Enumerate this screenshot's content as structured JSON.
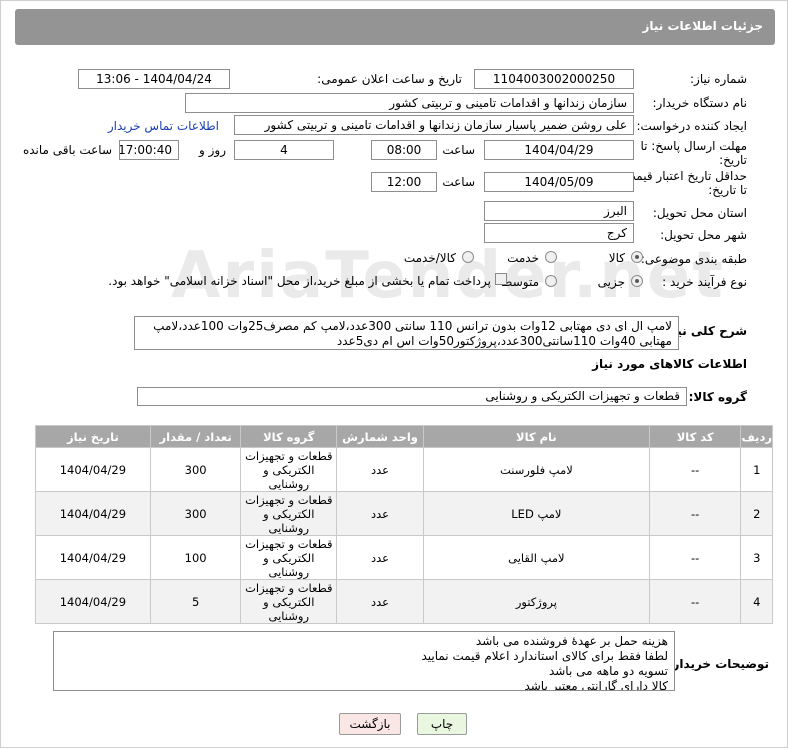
{
  "header": {
    "title": "جزئیات اطلاعات نیاز"
  },
  "watermark": "AriaTender.net",
  "form": {
    "need_number_label": "شماره نیاز:",
    "need_number": "1104003002000250",
    "announce_label": "تاریخ و ساعت اعلان عمومی:",
    "announce_value": "1404/04/24 - 13:06",
    "buyer_label": "نام دستگاه خریدار:",
    "buyer_value": "سازمان زندانها و اقدامات تامینی و تربیتی کشور",
    "creator_label": "ایجاد کننده درخواست:",
    "creator_value": "علی روشن ضمیر پاسیار سازمان زندانها و اقدامات تامینی و تربیتی کشور",
    "contact_link": "اطلاعات تماس خریدار",
    "deadline_label_1": "مهلت ارسال پاسخ: تا",
    "deadline_label_2": "تاریخ:",
    "deadline_date": "1404/04/29",
    "time_label": "ساعت",
    "deadline_time": "08:00",
    "days_value": "4",
    "days_label": "روز و",
    "remaining_time": "17:00:40",
    "remaining_label": "ساعت باقی مانده",
    "validity_label_1": "حداقل تاریخ اعتبار قیمت:",
    "validity_label_2": "تا تاریخ:",
    "validity_date": "1404/05/09",
    "validity_time": "12:00",
    "province_label": "استان محل تحویل:",
    "province_value": "البرز",
    "city_label": "شهر محل تحویل:",
    "city_value": "کرج",
    "category_label": "طبقه بندی موضوعی:",
    "category_options": [
      "کالا",
      "خدمت",
      "کالا/خدمت"
    ],
    "category_selected": "کالا",
    "purchase_label": "نوع فرآیند خرید :",
    "purchase_options": [
      "جزیی",
      "متوسط"
    ],
    "purchase_note": "پرداخت تمام یا بخشی از مبلغ خرید،از محل \"اسناد خزانه اسلامی\" خواهد بود.",
    "summary_label": "شرح کلی نیاز:",
    "summary_value": "لامپ ال ای دی مهتابی 12وات بدون ترانس 110 سانتی 300عدد،لامپ کم مصرف25وات 100عدد،لامپ مهتابی 40وات 110سانتی300عدد،پروژکتور50وات اس ام دی5عدد"
  },
  "goods": {
    "section_title": "اطلاعات کالاهای مورد نیاز",
    "group_label": "گروه کالا:",
    "group_value": "قطعات و تجهیزات الکتریکی و روشنایی",
    "columns": [
      "ردیف",
      "کد کالا",
      "نام کالا",
      "واحد شمارش",
      "گروه کالا",
      "تعداد / مقدار",
      "تاریخ نیاز"
    ],
    "rows": [
      {
        "idx": "1",
        "code": "--",
        "name": "لامپ فلورسنت",
        "unit": "عدد",
        "group": "قطعات و تجهیزات الکتریکی و روشنایی",
        "qty": "300",
        "date": "1404/04/29"
      },
      {
        "idx": "2",
        "code": "--",
        "name": "لامپ LED",
        "unit": "عدد",
        "group": "قطعات و تجهیزات الکتریکی و روشنایی",
        "qty": "300",
        "date": "1404/04/29"
      },
      {
        "idx": "3",
        "code": "--",
        "name": "لامپ القایی",
        "unit": "عدد",
        "group": "قطعات و تجهیزات الکتریکی و روشنایی",
        "qty": "100",
        "date": "1404/04/29"
      },
      {
        "idx": "4",
        "code": "--",
        "name": "پروژکتور",
        "unit": "عدد",
        "group": "قطعات و تجهیزات الکتریکی و روشنایی",
        "qty": "5",
        "date": "1404/04/29"
      }
    ]
  },
  "buyer_notes": {
    "label": "توضیحات خریدار:",
    "lines": [
      "هزینه حمل بر عهدۀ فروشنده می باشد",
      "لطفا فقط برای کالای استاندارد اعلام قیمت نمایید",
      "تسویه دو ماهه می باشد",
      "کالا دارای گارانتی معتبر باشد"
    ]
  },
  "actions": {
    "print": "چاپ",
    "back": "بازگشت"
  },
  "colors": {
    "header": "#949494",
    "table_header": "#a7a7a7",
    "print_btn": "#e9f7e1",
    "back_btn": "#fbe6e6",
    "link": "#1a3fb5"
  }
}
